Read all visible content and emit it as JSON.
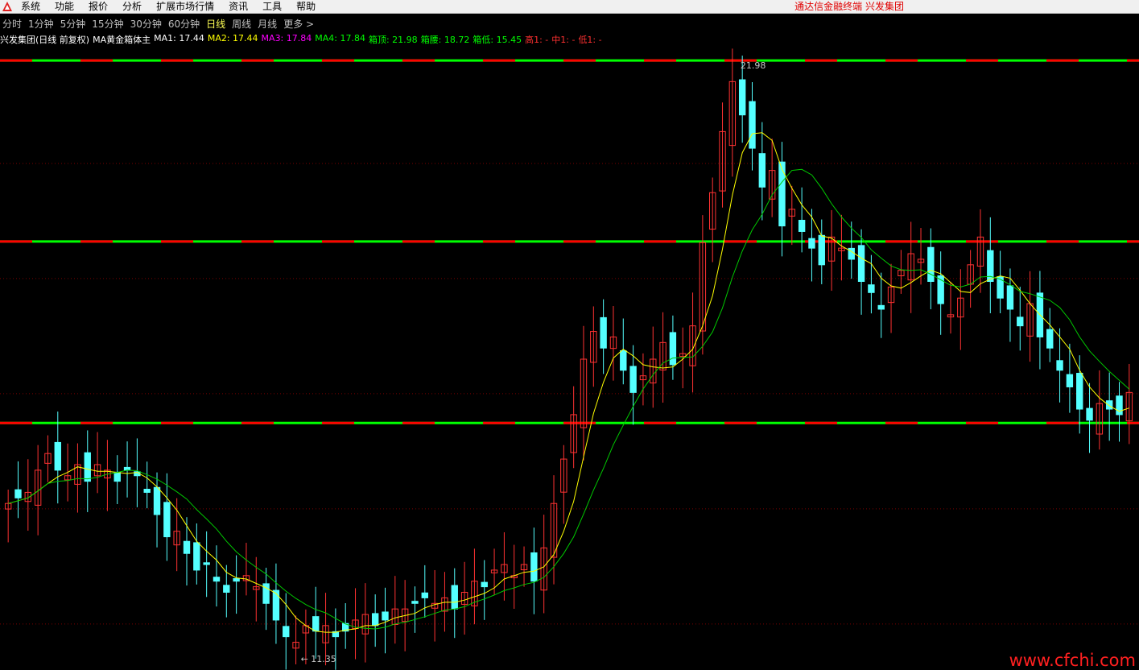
{
  "menu": {
    "items": [
      "系统",
      "功能",
      "报价",
      "分析",
      "扩展市场行情",
      "资讯",
      "工具",
      "帮助"
    ],
    "right_text": "通达信金融终端   兴发集团"
  },
  "tabs": [
    "分时",
    "1分钟",
    "5分钟",
    "15分钟",
    "30分钟",
    "60分钟",
    "日线",
    "周线",
    "月线",
    "更多 >"
  ],
  "active_tab": "日线",
  "legend": {
    "stock": "兴发集团(日线 前复权)",
    "indicator": "MA黄金箱体主",
    "ma1": "MA1: 17.44",
    "ma2": "MA2: 17.44",
    "ma3": "MA3: 17.84",
    "ma4": "MA4: 17.84",
    "box_top": "箱顶: 21.98",
    "box_mid": "箱腰: 18.72",
    "box_low": "箱低: 15.45",
    "high1": "高1: -",
    "mid1": "中1: -",
    "low1": "低1: -"
  },
  "colors": {
    "up": "#ff3232",
    "down": "#54ffff",
    "ma_yellow": "#ffff00",
    "ma_green": "#00c800",
    "box_red": "#ff0000",
    "box_green": "#00ff00",
    "grid": "#7a0000",
    "ma1": "#ffffff",
    "ma2": "#ffff00",
    "ma3": "#ff00ff",
    "ma4": "#00ff00",
    "legend_text": "#ffffff",
    "box_label": "#00ff00",
    "hml_label": "#ff3030"
  },
  "annotations": {
    "max_label": "21.98",
    "min_label": "11.35"
  },
  "watermark": "www.cfchi.com",
  "chart_data": {
    "type": "candlestick",
    "price_range": [
      11.0,
      22.2
    ],
    "box_lines": {
      "top": 21.98,
      "mid": 18.72,
      "low": 15.45
    },
    "max": 21.98,
    "min": 11.35,
    "closes": [
      14.0,
      14.1,
      14.2,
      14.6,
      14.9,
      14.6,
      14.5,
      14.7,
      14.4,
      14.7,
      14.6,
      14.4,
      14.6,
      14.5,
      14.2,
      13.8,
      13.4,
      13.5,
      13.1,
      12.8,
      12.9,
      12.6,
      12.4,
      12.6,
      12.7,
      12.5,
      12.2,
      11.9,
      11.6,
      11.5,
      11.8,
      11.7,
      11.8,
      11.6,
      11.7,
      11.9,
      12.0,
      11.8,
      11.9,
      12.1,
      12.1,
      12.2,
      12.3,
      12.2,
      12.3,
      12.1,
      12.4,
      12.6,
      12.5,
      12.8,
      12.9,
      12.7,
      12.9,
      12.6,
      13.2,
      14.0,
      14.8,
      15.6,
      16.6,
      17.1,
      16.8,
      17.0,
      16.4,
      16.0,
      16.3,
      16.6,
      16.9,
      16.5,
      16.7,
      17.2,
      18.7,
      19.6,
      20.7,
      21.6,
      21.0,
      20.4,
      19.7,
      20.0,
      19.0,
      19.3,
      18.9,
      18.6,
      18.3,
      18.8,
      18.6,
      18.4,
      18.0,
      17.8,
      17.5,
      17.9,
      18.2,
      18.5,
      18.4,
      18.0,
      17.6,
      17.4,
      17.7,
      18.3,
      18.8,
      18.0,
      17.7,
      17.5,
      17.2,
      17.6,
      17.0,
      16.8,
      16.4,
      16.1,
      15.7,
      15.5,
      15.8,
      15.7,
      15.6,
      16.0
    ]
  }
}
